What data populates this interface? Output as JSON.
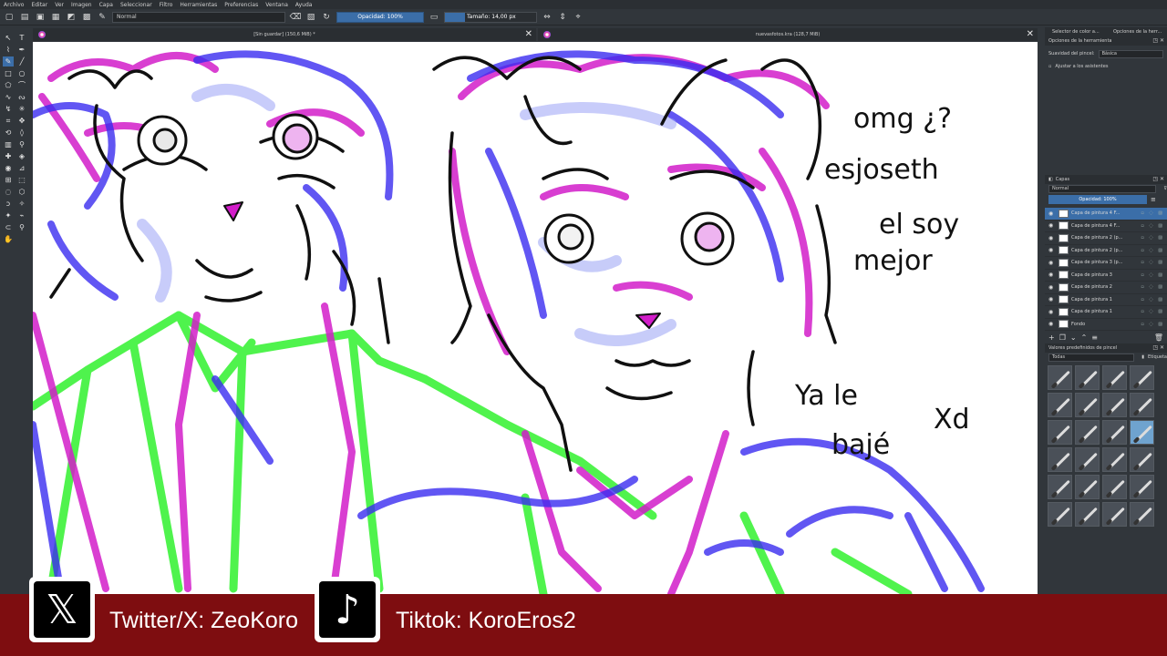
{
  "menu": [
    "Archivo",
    "Editar",
    "Ver",
    "Imagen",
    "Capa",
    "Seleccionar",
    "Filtro",
    "Herramientas",
    "Preferencias",
    "Ventana",
    "Ayuda"
  ],
  "toolbar": {
    "blend_mode": "Normal",
    "opacity_label": "Opacidad: 100%",
    "size_label": "Tamaño: 14,00 px"
  },
  "tabs": {
    "doc1": "[Sin guardar] (150,6 MiB) *",
    "doc2": "nuevasfotos.kra (128,7 MiB)"
  },
  "dockers": {
    "tab1": "Selector de color a...",
    "tab2": "Opciones de la herr...",
    "tool_options_title": "Opciones de la herramienta",
    "smoothing_label": "Suavidad del pincel:",
    "smoothing_value": "Básica",
    "snap_label": "Ajustar a los asistentes",
    "layers_title": "Capas",
    "layer_blend": "Normal",
    "layer_opacity": "Opacidad: 100%",
    "layers": [
      {
        "name": "Capa de pintura 4 F..."
      },
      {
        "name": "Capa de pintura 4 F..."
      },
      {
        "name": "Capa de pintura 2 (p..."
      },
      {
        "name": "Capa de pintura 2 (p..."
      },
      {
        "name": "Capa de pintura 3 (p..."
      },
      {
        "name": "Capa de pintura 3"
      },
      {
        "name": "Capa de pintura 2"
      },
      {
        "name": "Capa de pintura 1"
      },
      {
        "name": "Capa de pintura 1"
      },
      {
        "name": "Fondo"
      }
    ],
    "brushes_title": "Valores predefinidos de pincel",
    "brush_filter": "Todas",
    "brush_tag": "Etiqueta"
  },
  "canvas_text": {
    "line1": "omg ¿?",
    "line2": "esjoseth",
    "line3": "el soy",
    "line4": "mejor",
    "line5": "Ya le",
    "line6": "bajé",
    "line7": "Xd"
  },
  "banner": {
    "twitter_text": "Twitter/X: ZeoKoro",
    "tiktok_text": "Tiktok: KoroEros2"
  },
  "colors": {
    "banner": "#7e0d10",
    "accent": "#3b6ea8",
    "stroke_blue": "#3a2cf0",
    "stroke_magenta": "#d21dc9",
    "stroke_green": "#3df23a"
  }
}
